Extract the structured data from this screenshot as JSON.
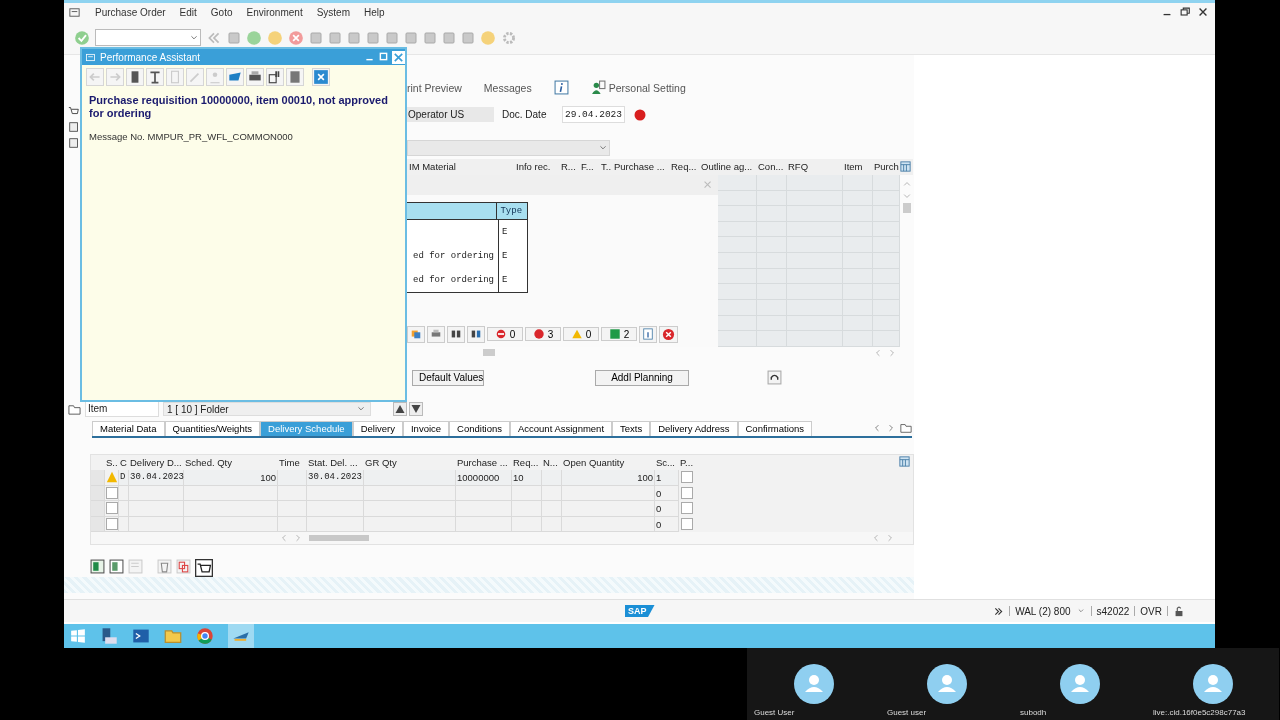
{
  "menu_bar": {
    "items": [
      "Purchase Order",
      "Edit",
      "Goto",
      "Environment",
      "System",
      "Help"
    ]
  },
  "popup": {
    "title": "Performance Assistant",
    "heading": "Purchase requisition 10000000, item 00010, not approved for ordering",
    "message_no": "Message No. MMPUR_PR_WFL_COMMON000"
  },
  "app_toolbar": {
    "items": [
      {
        "kind": "text",
        "label": "rint Preview"
      },
      {
        "kind": "text",
        "label": "Messages"
      },
      {
        "kind": "info"
      },
      {
        "kind": "person",
        "label": "Personal Setting"
      }
    ]
  },
  "header_fields": {
    "operator": "Operator US",
    "doc_date_label": "Doc. Date",
    "doc_date": "29.04.2023"
  },
  "items_table": {
    "columns": [
      "IM Material",
      "Info rec.",
      "R...",
      "F...",
      "T..",
      "Purchase ...",
      "Req...",
      "Outline ag...",
      "Con...",
      "RFQ",
      "Item",
      "Purch"
    ]
  },
  "message_log": {
    "column": "Type",
    "rows": [
      {
        "type": "E"
      },
      {
        "text": "ed for ordering",
        "type": "E"
      },
      {
        "text": "ed for ordering",
        "type": "E"
      }
    ],
    "counters": [
      {
        "kind": "stop",
        "count": "0"
      },
      {
        "kind": "error",
        "count": "3"
      },
      {
        "kind": "warning",
        "count": "0"
      },
      {
        "kind": "success",
        "count": "2"
      }
    ]
  },
  "buttons": [
    "Default Values",
    "Addl Planning"
  ],
  "item_nav": {
    "label": "Item",
    "folder": "1 [ 10 ] Folder"
  },
  "tabs": [
    {
      "label": "Material Data",
      "selected": false
    },
    {
      "label": "Quantities/Weights",
      "selected": false
    },
    {
      "label": "Delivery Schedule",
      "selected": true
    },
    {
      "label": "Delivery",
      "selected": false
    },
    {
      "label": "Invoice",
      "selected": false
    },
    {
      "label": "Conditions",
      "selected": false
    },
    {
      "label": "Account Assignment",
      "selected": false
    },
    {
      "label": "Texts",
      "selected": false
    },
    {
      "label": "Delivery Address",
      "selected": false
    },
    {
      "label": "Confirmations",
      "selected": false
    }
  ],
  "schedule_table": {
    "columns": [
      "S..",
      "C",
      "Delivery D...",
      "Sched. Qty",
      "Time",
      "Stat. Del. ...",
      "GR Qty",
      "Purchase ...",
      "Req...",
      "N...",
      "Open Quantity",
      "Sc...",
      "P..."
    ],
    "rows": [
      {
        "warning": true,
        "p_checked": false,
        "cells": [
          null,
          "D",
          "30.04.2023",
          "100",
          null,
          "30.04.2023",
          null,
          "10000000",
          "10",
          null,
          "100",
          "1"
        ]
      },
      {
        "warning": false,
        "p_checked": false,
        "cells": [
          null,
          null,
          null,
          null,
          null,
          null,
          null,
          null,
          null,
          null,
          null,
          "0"
        ]
      },
      {
        "warning": false,
        "p_checked": false,
        "cells": [
          null,
          null,
          null,
          null,
          null,
          null,
          null,
          null,
          null,
          null,
          null,
          "0"
        ]
      },
      {
        "warning": false,
        "p_checked": false,
        "cells": [
          null,
          null,
          null,
          null,
          null,
          null,
          null,
          null,
          null,
          null,
          null,
          "0"
        ]
      }
    ]
  },
  "status_bar": {
    "logo": "SAP",
    "system": "WAL (2) 800",
    "server": "s42022",
    "mode": "OVR"
  },
  "participants": [
    "Guest User",
    "Guest user",
    "subodh",
    "live:.cid.16f0e5c298c77a3"
  ]
}
